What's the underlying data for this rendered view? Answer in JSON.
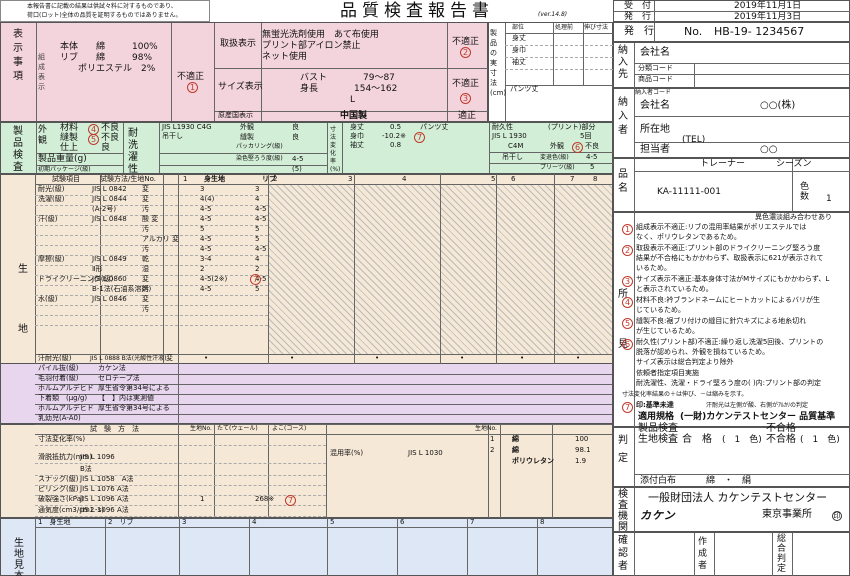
{
  "notice": [
    "本報告書に記載の結果は供試々料に対するものであり、",
    "荷口(ロット)全体の品質を証明するものではありません。"
  ],
  "title": "品質検査報告書",
  "version": "(ver.14.8)",
  "meta": {
    "received_label": "受　付",
    "received": "2019年11月1日",
    "issued_label": "発　行",
    "issued": "2019年11月3日"
  },
  "report": {
    "label": "発　行",
    "no_label": "No.",
    "no": "HB-19- 1234567"
  },
  "labeling": {
    "section": "表示事項",
    "comp_label": "組成表示",
    "comp": [
      "本体　　綿　　　100%",
      "リブ　　綿　　　98%",
      "　　ポリエステル　2%"
    ],
    "comp_result": "不適正",
    "handling_label": "取扱表示",
    "handling": [
      "無蛍光洗剤使用　あて布使用",
      "プリント部アイロン禁止",
      "ネット使用"
    ],
    "handling_result": "不適正",
    "size_label": "サイズ表示",
    "size": [
      "バスト　　　　79～87",
      "身長　　　　154～162",
      "L"
    ],
    "size_result": "不適正",
    "origin_label": "原産国表示",
    "origin": "中国製",
    "origin_result": "適正"
  },
  "product_measure": {
    "label": "製品の実寸法(cm)",
    "cols": [
      "部位",
      "処理前",
      "伸び寸法"
    ],
    "rows": [
      "身丈",
      "身巾",
      "袖丈"
    ],
    "pants": "パンツ丈"
  },
  "customer": {
    "delivery": "納入先",
    "company": "会社名",
    "cat_code": "分類コード",
    "item_code": "商品コード",
    "vendor_code": "納入者コード",
    "vendor": "納入者",
    "vendor_company": "会社名",
    "vendor_name": "○○(株)",
    "address": "所在地",
    "tel": "(TEL)",
    "person": "担当者",
    "person_name": "○○",
    "product": "品名",
    "product_type": "トレーナー",
    "season": "シーズン",
    "product_no": "KA-11111-001",
    "colors_label": "色数",
    "colors": "1"
  },
  "inspection": {
    "section": "製品検査",
    "appearance": "外観",
    "material": "材料",
    "material_r": "不良",
    "sewing": "縫製",
    "sewing_r": "不良",
    "finish": "仕上",
    "finish_r": "良",
    "weight": "製品重量(g)",
    "init_pkg": "初期パッケージ(級)",
    "wash": "耐洗濯性",
    "wash_std": "JIS L1930 C4G",
    "hang": "吊干し",
    "wash_app": "外観",
    "wash_app_r": "良",
    "wash_sew": "縫製",
    "wash_sew_r": "良",
    "pucker": "パッカリング(級)",
    "color_change": "染色堅ろう度(級)",
    "cc_val": "4-5",
    "cc_sub": "(5)",
    "dim": "寸法変化率(%)",
    "dim_rows": [
      [
        "身丈",
        "0.5"
      ],
      [
        "身巾",
        "-10.2※"
      ],
      [
        "袖丈",
        "0.8"
      ]
    ],
    "pants": "パンツ丈",
    "durability": "耐久性",
    "print": "(プリント)部分",
    "dur_std": "JIS L 1930",
    "dur_c": "C4M",
    "dur_times": "5回",
    "dur_hang": "吊干し",
    "dur_app": "外観",
    "dur_app_r": "不良",
    "dur_col": "変退色(級)",
    "dur_col_r": "4-5",
    "dur_stain": "プリーツ(級)",
    "dur_stain_r": "5"
  },
  "fabric": {
    "section": "生地",
    "hdr_item": "試験項目",
    "hdr_method": "試験方法/生地No.",
    "cols": [
      "1",
      "2",
      "3",
      "4",
      "5",
      "6",
      "7",
      "8"
    ],
    "col1": "身生地",
    "col2": "リブ",
    "rows": [
      {
        "name": "耐光(級)",
        "method": "JIS L 0842",
        "sub": "変",
        "v1": "3",
        "v2": "3"
      },
      {
        "name": "洗濯(級)",
        "method": "JIS L 0844",
        "sub": "変",
        "v1": "4(4)",
        "v2": "4"
      },
      {
        "name": "",
        "method": "(A-2号)",
        "sub": "汚",
        "v1": "4-5",
        "v2": "4-5"
      },
      {
        "name": "汗(級)",
        "method": "JIS L 0848",
        "sub": "酸 変",
        "v1": "4-5",
        "v2": "4-5"
      },
      {
        "name": "",
        "method": "",
        "sub": "汚",
        "v1": "5",
        "v2": "5"
      },
      {
        "name": "",
        "method": "",
        "sub": "アルカリ 変",
        "v1": "4-5",
        "v2": "5"
      },
      {
        "name": "",
        "method": "",
        "sub": "汚",
        "v1": "4-5",
        "v2": "4-5"
      },
      {
        "name": "摩擦(級)",
        "method": "JIS L 0849",
        "sub": "乾",
        "v1": "3-4",
        "v2": "4"
      },
      {
        "name": "",
        "method": "Ⅱ形",
        "sub": "湿",
        "v1": "2",
        "v2": "2"
      },
      {
        "name": "ドライクリーニング(級)",
        "method": "JIS L 0860",
        "sub": "変",
        "v1": "4-5(2※)",
        "v2": "4-5"
      },
      {
        "name": "",
        "method": "B-1法(石油系溶剤)",
        "sub": "汚",
        "v1": "4-5",
        "v2": "5"
      },
      {
        "name": "水(級)",
        "method": "JIS L 0846",
        "sub": "変",
        "v1": "",
        "v2": ""
      },
      {
        "name": "",
        "method": "",
        "sub": "汚",
        "v1": "",
        "v2": ""
      },
      {
        "name": "",
        "method": "",
        "sub": "",
        "v1": "",
        "v2": ""
      }
    ],
    "sweat_light": "汗耐光(級)",
    "sweat_light_m": "JIS L 0888 B法(光酸性汗液)",
    "sweat_light_sub": "変",
    "pilling": "パイル抜(級)",
    "pilling_m": "カケン法",
    "hair": "毛羽付着(級)",
    "hair_m": "セロテープ法",
    "formal1": "ホルムアルデヒド",
    "formal1_m": "厚生省令第34号による",
    "under": "下着類　(μg/g)",
    "under_m": "【　】内は実測値",
    "formal2": "ホルムアルデヒド",
    "formal2_m": "厚生省令第34号による",
    "infant": "乳幼児(A-A0)",
    "phys_hdr": "試　験　方　法",
    "phys_no": "生地No.",
    "tate": "たて(ウェール)",
    "yoko": "よこ(コース)",
    "dim_chg": "寸法変化率(%)",
    "slip": "滑脱抵抗力(mm)",
    "slip_m": "JIS L 1096",
    "slip_b": "B法",
    "snag": "スナッグ(級)",
    "snag_m": "JIS L 1058　A法",
    "pill": "ピリング(級)",
    "pill_m": "JIS L 1076 A法",
    "burst": "破裂強さ(kPa)",
    "burst_m": "JIS L 1096 A法",
    "burst_no": "1",
    "burst_v": "268※",
    "air": "通気度(cm3/cm2･s)",
    "air_m": "JIS L 1096 A法",
    "mix": "混用率(%)",
    "mix_m": "JIS L 1030",
    "mix_no": "生地No.",
    "mix_rows": [
      [
        "1",
        "綿",
        "100"
      ],
      [
        "2",
        "綿",
        "98.1"
      ],
      [
        "",
        "ポリウレタン",
        "1.9"
      ]
    ],
    "sample": "生地見本",
    "sample_cols": [
      "1　身生地",
      "2　リブ",
      "3",
      "4",
      "5",
      "6",
      "7",
      "8"
    ]
  },
  "remarks": {
    "section": "所見",
    "head": "異色濃淡組み合わせあり",
    "items": [
      {
        "n": "1",
        "t": "組成表示不適正:リブの混用率結果がポリエステルでは",
        "t2": "なく、ポリウレタンであるため。"
      },
      {
        "n": "2",
        "t": "取扱表示不適正:プリント部のドライクリーニング堅ろう度",
        "t2": "結果が不合格にもかかわらず、取扱表示に621が表示されて",
        "t3": "いるため。"
      },
      {
        "n": "3",
        "t": "サイズ表示不適正:基本身体寸法がMサイズにもかかわらず、L",
        "t2": "と表示されているため。"
      },
      {
        "n": "4",
        "t": "材料不良:衿ブランドネームにヒートカットによるバリが生",
        "t2": "じているため。"
      },
      {
        "n": "5",
        "t": "縫製不良:裾ブリ付けの縫目に針穴キズによる地糸切れ",
        "t2": "が生じているため。"
      },
      {
        "n": "6",
        "t": "耐久性(プリント部)不適正:繰り返し洗濯5回後、プリントの",
        "t2": "脱落が認められ、外観を損ねているため。",
        "t3": "サイズ表示は総合判定より除外"
      }
    ],
    "req": "依頼者指定項目実施",
    "req2": "耐洗濯性、洗濯・ドライ堅ろう度の( )内:プリント部の判定",
    "note": "寸法変化率結果の＋は伸び、－は縮みを示す。",
    "n7": "7",
    "n7t": "印:基準未達",
    "n7t2": "汗耐光は左側が酸、右側がｱﾙｶﾘの判定"
  },
  "judgement": {
    "section": "判定",
    "std_label": "適用規格",
    "std": "(一財)カケンテストセンター 品質基準",
    "prod_label": "製品検査",
    "prod": "不合格",
    "fabric_label": "生地検査",
    "fabric": "合　格",
    "color1": "(　1　色)",
    "fabric_ng": "不合格",
    "color2": "(　1　色)",
    "tag": "添付白布",
    "tag_v": "綿　・　絹"
  },
  "agency": {
    "section": "検査機関",
    "org": "一般財団法人 カケンテストセンター",
    "office": "東京事業所",
    "logo": "カケン",
    "seal": "印"
  },
  "confirm": {
    "label": "確認者",
    "maker": "作成者",
    "total": "総合判定"
  }
}
